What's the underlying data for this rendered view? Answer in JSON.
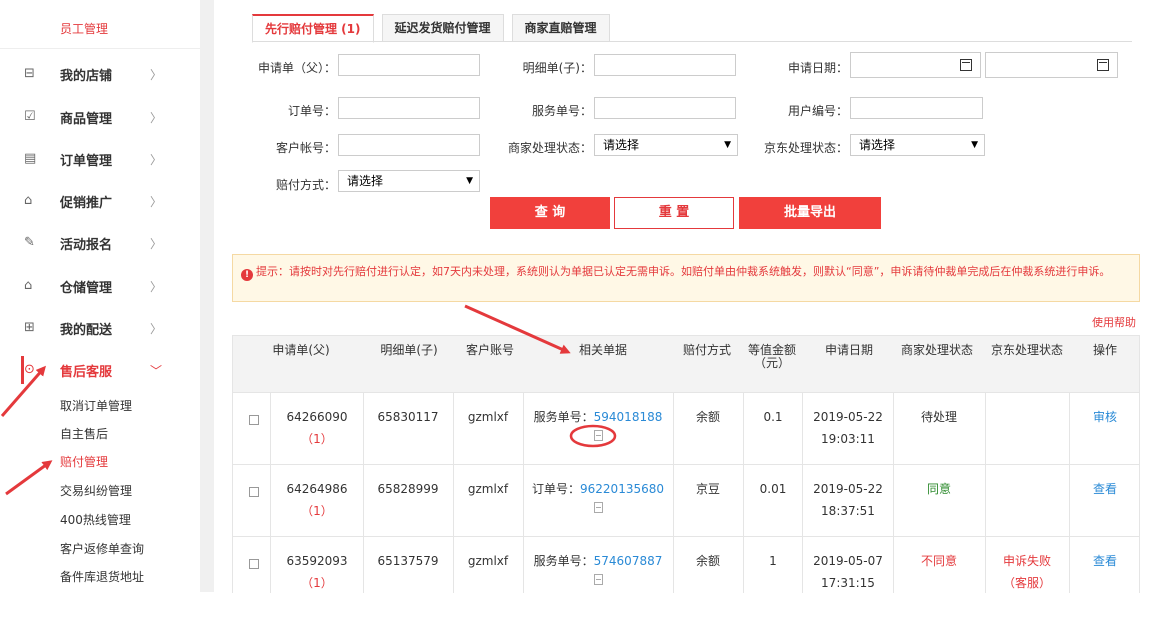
{
  "sidebar": {
    "top_item": "员工管理",
    "items": [
      {
        "label": "我的店铺",
        "icon": "shop-icon",
        "glyph": "⊟"
      },
      {
        "label": "商品管理",
        "icon": "product-icon",
        "glyph": "☑"
      },
      {
        "label": "订单管理",
        "icon": "order-icon",
        "glyph": "▤"
      },
      {
        "label": "促销推广",
        "icon": "promotion-icon",
        "glyph": "⌂"
      },
      {
        "label": "活动报名",
        "icon": "activity-icon",
        "glyph": "✎"
      },
      {
        "label": "仓储管理",
        "icon": "warehouse-icon",
        "glyph": "⌂"
      },
      {
        "label": "我的配送",
        "icon": "delivery-icon",
        "glyph": "⊞"
      },
      {
        "label": "售后客服",
        "icon": "service-icon",
        "glyph": "⊙"
      }
    ],
    "sub_items": [
      "取消订单管理",
      "自主售后",
      "赔付管理",
      "交易纠纷管理",
      "400热线管理",
      "客户返修单查询",
      "备件库退货地址"
    ]
  },
  "tabs": [
    "先行赔付管理 (1)",
    "延迟发货赔付管理",
    "商家直赔管理"
  ],
  "form": {
    "parent_no_label": "申请单（父）：",
    "child_no_label": "明细单(子)：",
    "apply_date_label": "申请日期：",
    "order_no_label": "订单号：",
    "service_no_label": "服务单号：",
    "user_no_label": "用户编号：",
    "customer_account_label": "客户帐号：",
    "merchant_status_label": "商家处理状态：",
    "jd_status_label": "京东处理状态：",
    "pay_method_label": "赔付方式：",
    "select_placeholder": "请选择"
  },
  "buttons": {
    "query": "查 询",
    "reset": "重 置",
    "export": "批量导出"
  },
  "notice": {
    "icon": "!",
    "text": "提示：请按时对先行赔付进行认定，如7天内未处理，系统则认为单据已认定无需申诉。如赔付单由仲裁系统触发，则默认“同意”，申诉请待仲裁单完成后在仲裁系统进行申诉。"
  },
  "help_link": "使用帮助",
  "table": {
    "headers": [
      "申请单(父)",
      "明细单(子)",
      "客户账号",
      "相关单据",
      "赔付方式",
      "等值金额（元）",
      "申请日期",
      "商家处理状态",
      "京东处理状态",
      "操作"
    ],
    "rows": [
      {
        "parent": "64266090",
        "parent_sub": "（1）",
        "child": "65830117",
        "account": "gzmlxf",
        "doc_label": "服务单号：",
        "doc_no": "594018188",
        "method": "余额",
        "amount": "0.1",
        "date": "2019-05-22",
        "time": "19:03:11",
        "merchant_status": "待处理",
        "jd_status": "",
        "jd_status_sub": "",
        "action": "审核"
      },
      {
        "parent": "64264986",
        "parent_sub": "（1）",
        "child": "65828999",
        "account": "gzmlxf",
        "doc_label": "订单号：",
        "doc_no": "96220135680",
        "method": "京豆",
        "amount": "0.01",
        "date": "2019-05-22",
        "time": "18:37:51",
        "merchant_status": "同意",
        "jd_status": "",
        "jd_status_sub": "",
        "action": "查看"
      },
      {
        "parent": "63592093",
        "parent_sub": "（1）",
        "child": "65137579",
        "account": "gzmlxf",
        "doc_label": "服务单号：",
        "doc_no": "574607887",
        "method": "余额",
        "amount": "1",
        "date": "2019-05-07",
        "time": "17:31:15",
        "merchant_status": "不同意",
        "jd_status": "申诉失败",
        "jd_status_sub": "（客服）",
        "action": "查看"
      }
    ]
  },
  "colors": {
    "accent": "#e4393c",
    "link": "#2a8ad6",
    "agree": "#2e8b2e"
  }
}
